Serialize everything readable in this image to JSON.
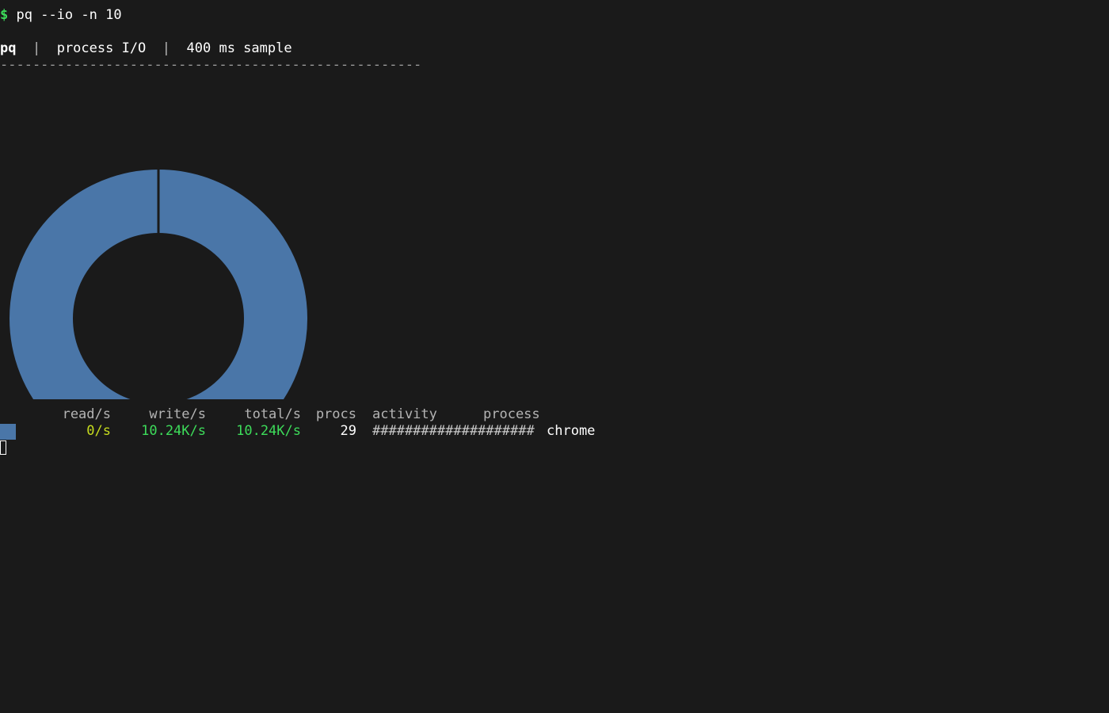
{
  "terminal": {
    "prompt_symbol": "$",
    "command": "pq --io -n 10"
  },
  "header": {
    "app": "pq",
    "separator": "|",
    "mode": "process I/O",
    "sample": "400 ms sample",
    "rule": "----------------------------------------------------"
  },
  "chart_data": {
    "type": "pie",
    "style": "donut",
    "slices": [
      {
        "label": "chrome",
        "value": 10240,
        "color": "#4a76a8"
      }
    ]
  },
  "table": {
    "headers": [
      "read/s",
      "write/s",
      "total/s",
      "procs",
      "activity",
      "process"
    ],
    "rows": [
      {
        "swatch_color": "#4a76a8",
        "read": "0/s",
        "write": "10.24K/s",
        "total": "10.24K/s",
        "procs": "29",
        "activity": "####################",
        "process": "chrome"
      }
    ]
  },
  "colors": {
    "background": "#1a1a1a",
    "prompt": "#3ddc5a",
    "read": "#c6dc1e",
    "write": "#3ddc5a",
    "series": "#4a76a8"
  }
}
